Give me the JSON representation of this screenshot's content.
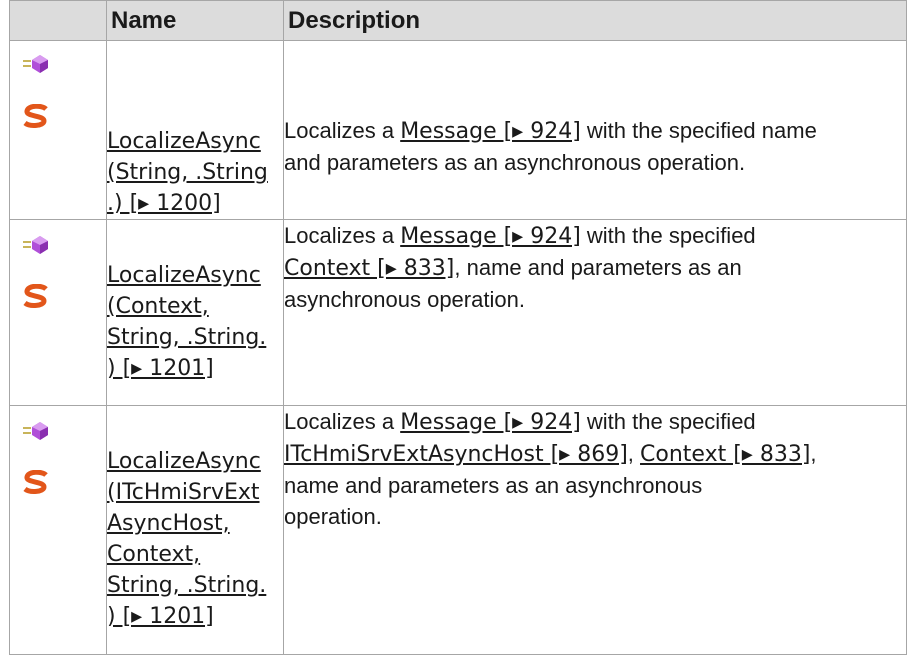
{
  "table": {
    "headers": {
      "icon": "",
      "name": "Name",
      "description": "Description"
    },
    "rows": [
      {
        "icons": [
          "method-icon",
          "static-icon"
        ],
        "name_lines": [
          "LocalizeAsync",
          "(String, .String",
          ".) [▸ 1200]"
        ],
        "desc": {
          "l1_pre": "Localizes a ",
          "l1_link": "Message [▸ 924]",
          "l1_post": " with the specified name",
          "l2": "and parameters as an asynchronous operation."
        }
      },
      {
        "icons": [
          "method-icon",
          "static-icon"
        ],
        "name_lines": [
          "LocalizeAsync",
          "(Context,",
          "String, .String.",
          ") [▸ 1201]"
        ],
        "desc": {
          "l1_pre": "Localizes a ",
          "l1_link": "Message [▸ 924]",
          "l1_post": " with the specified",
          "l2_link": "Context [▸ 833]",
          "l2_post": ", name and parameters as an",
          "l3": "asynchronous operation."
        }
      },
      {
        "icons": [
          "method-icon",
          "static-icon"
        ],
        "name_lines": [
          "LocalizeAsync",
          "(ITcHmiSrvExt",
          "AsyncHost,",
          "Context,",
          "String, .String.",
          ") [▸ 1201]"
        ],
        "desc": {
          "l1_pre": "Localizes a ",
          "l1_link": "Message [▸ 924]",
          "l1_post": " with the specified",
          "l2_link1": "ITcHmiSrvExtAsyncHost [▸ 869]",
          "l2_mid": ", ",
          "l2_link2": "Context [▸ 833]",
          "l2_post": ",",
          "l3": "name and parameters as an asynchronous",
          "l4": "operation."
        }
      }
    ]
  },
  "colors": {
    "header_bg": "#dcdcdc",
    "border": "#a6a6a6",
    "method_icon": "#b04fd8",
    "static_icon": "#e2561a"
  }
}
